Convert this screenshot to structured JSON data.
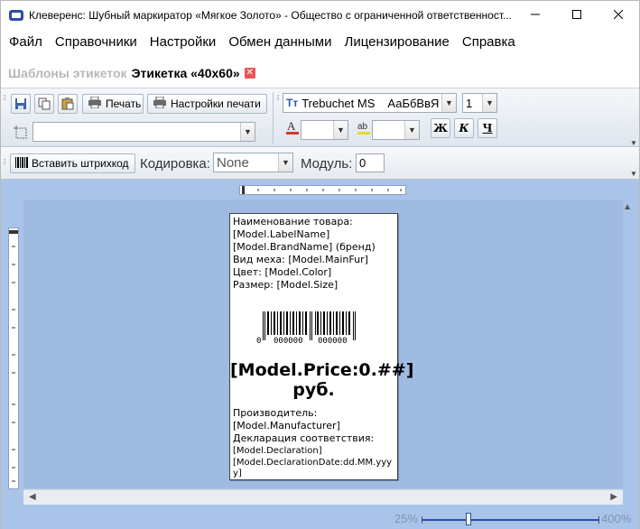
{
  "window": {
    "title": "Клеверенс: Шубный маркиратор «Мягкое Золото» - Общество с ограниченной ответственност..."
  },
  "menu": [
    "Файл",
    "Справочники",
    "Настройки",
    "Обмен данными",
    "Лицензирование",
    "Справка"
  ],
  "tabs": {
    "inactive": "Шаблоны этикеток",
    "active": "Этикетка «40x60»"
  },
  "toolbar": {
    "print_label": "Печать",
    "print_settings_label": "Настройки печати",
    "font_name": "Trebuchet MS",
    "font_preview": "АаБбВвЯ",
    "font_size": "1",
    "bold_label": "Ж",
    "italic_label": "К",
    "underline_label": "Ч"
  },
  "barcode_toolbar": {
    "insert_barcode_label": "Вставить штрихкод",
    "encoding_label": "Кодировка:",
    "encoding_value": "None",
    "module_label": "Модуль:",
    "module_value": "0"
  },
  "label": {
    "lines_top": [
      "Наименование товара:",
      "[Model.LabelName]",
      "[Model.BrandName] (бренд)",
      "Вид меха: [Model.MainFur]",
      "Цвет: [Model.Color]",
      "Размер: [Model.Size]"
    ],
    "barcode_digits": [
      "0",
      "000000",
      "000000"
    ],
    "price_line1": "[Model.Price:0.##]",
    "price_line2": "руб.",
    "lines_bottom": [
      "Производитель:",
      "[Model.Manufacturer]",
      "Декларация соответствия:",
      "[Model.Declaration]",
      "[Model.DeclarationDate:dd.MM.yyy",
      "y]"
    ]
  },
  "zoom": {
    "min_label": "25%",
    "max_label": "400%",
    "level_fraction": 0.25
  },
  "colors": {
    "design_bg": "#a9c4e8",
    "accent": "#2b4ea3",
    "tab_close": "#e8585a"
  }
}
